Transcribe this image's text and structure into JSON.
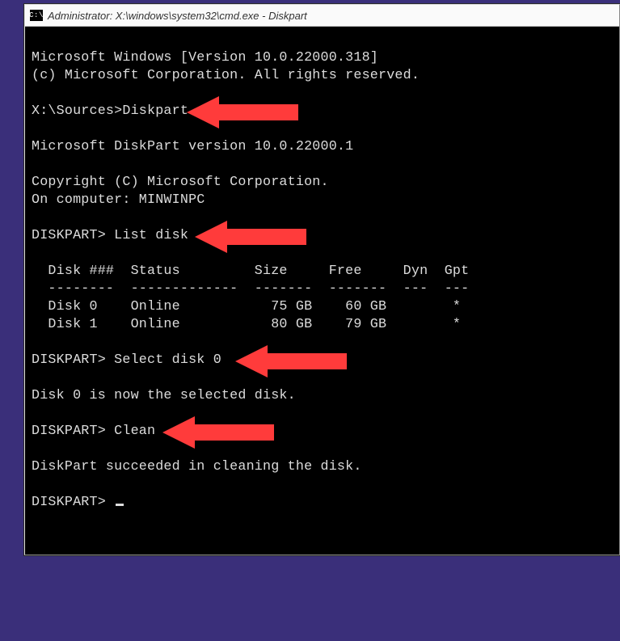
{
  "window": {
    "icon_label": "C:\\",
    "title": "Administrator: X:\\windows\\system32\\cmd.exe - Diskpart"
  },
  "lines": {
    "l0": "Microsoft Windows [Version 10.0.22000.318]",
    "l1": "(c) Microsoft Corporation. All rights reserved.",
    "l2": "",
    "l3": "X:\\Sources>Diskpart",
    "l4": "",
    "l5": "Microsoft DiskPart version 10.0.22000.1",
    "l6": "",
    "l7": "Copyright (C) Microsoft Corporation.",
    "l8": "On computer: MINWINPC",
    "l9": "",
    "l10": "DISKPART> List disk",
    "l11": "",
    "l12": "  Disk ###  Status         Size     Free     Dyn  Gpt",
    "l13": "  --------  -------------  -------  -------  ---  ---",
    "l14": "  Disk 0    Online           75 GB    60 GB        *",
    "l15": "  Disk 1    Online           80 GB    79 GB        *",
    "l16": "",
    "l17": "DISKPART> Select disk 0",
    "l18": "",
    "l19": "Disk 0 is now the selected disk.",
    "l20": "",
    "l21": "DISKPART> Clean",
    "l22": "",
    "l23": "DiskPart succeeded in cleaning the disk.",
    "l24": "",
    "l25": "DISKPART> "
  },
  "table": {
    "headers": [
      "Disk ###",
      "Status",
      "Size",
      "Free",
      "Dyn",
      "Gpt"
    ],
    "rows": [
      {
        "disk": "Disk 0",
        "status": "Online",
        "size": "75 GB",
        "free": "60 GB",
        "dyn": "",
        "gpt": "*"
      },
      {
        "disk": "Disk 1",
        "status": "Online",
        "size": "80 GB",
        "free": "79 GB",
        "dyn": "",
        "gpt": "*"
      }
    ]
  },
  "annotations": {
    "arrow_color": "#ff3b3b",
    "arrows": [
      {
        "points_to": "Diskpart command"
      },
      {
        "points_to": "List disk command"
      },
      {
        "points_to": "Select disk 0 command"
      },
      {
        "points_to": "Clean command"
      }
    ]
  }
}
